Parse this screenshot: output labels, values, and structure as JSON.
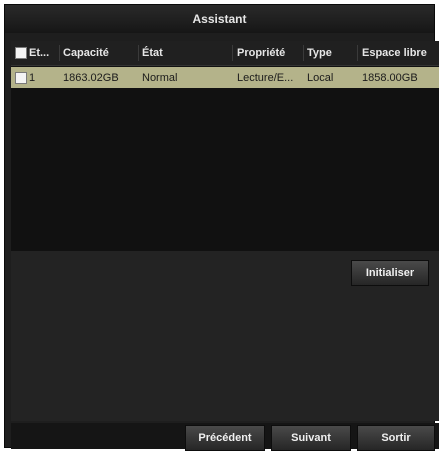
{
  "window": {
    "title": "Assistant"
  },
  "table": {
    "columns": [
      "Et...",
      "Capacité",
      "État",
      "Propriété",
      "Type",
      "Espace libre"
    ],
    "rows": [
      {
        "id": "1",
        "capacity": "1863.02GB",
        "state": "Normal",
        "property": "Lecture/E...",
        "type": "Local",
        "free": "1858.00GB"
      }
    ]
  },
  "buttons": {
    "initialize": "Initialiser",
    "previous": "Précédent",
    "next": "Suivant",
    "exit": "Sortir"
  },
  "colors": {
    "selected_row": "#b4b38a",
    "background": "#1e1e1e"
  }
}
